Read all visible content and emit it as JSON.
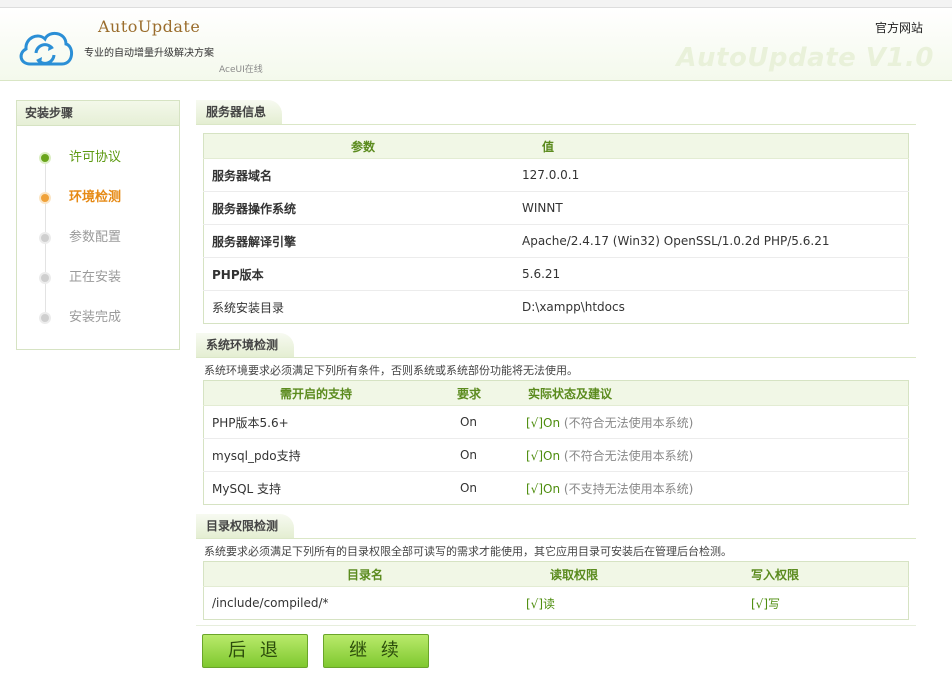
{
  "header": {
    "app_name": "AutoUpdate",
    "slogan": "专业的自动增量升级解决方案",
    "sub": "AceUI在线",
    "official_link": "官方网站",
    "watermark": "AutoUpdate V1.0"
  },
  "sidebar": {
    "title": "安装步骤",
    "steps": [
      {
        "label": "许可协议",
        "state": "done"
      },
      {
        "label": "环境检测",
        "state": "active"
      },
      {
        "label": "参数配置",
        "state": "pending"
      },
      {
        "label": "正在安装",
        "state": "pending"
      },
      {
        "label": "安装完成",
        "state": "pending"
      }
    ]
  },
  "server": {
    "title": "服务器信息",
    "headers": [
      "参数",
      "值"
    ],
    "rows": [
      {
        "param": "服务器域名",
        "value": "127.0.0.1"
      },
      {
        "param": "服务器操作系统",
        "value": "WINNT"
      },
      {
        "param": "服务器解译引擎",
        "value": "Apache/2.4.17 (Win32) OpenSSL/1.0.2d PHP/5.6.21"
      },
      {
        "param": "PHP版本",
        "value": "5.6.21"
      },
      {
        "param": "系统安装目录",
        "value": "D:\\xampp\\htdocs"
      }
    ]
  },
  "env": {
    "title": "系统环境检测",
    "desc": "系统环境要求必须满足下列所有条件，否则系统或系统部份功能将无法使用。",
    "headers": [
      "需开启的支持",
      "要求",
      "实际状态及建议"
    ],
    "rows": [
      {
        "name": "PHP版本5.6+",
        "req": "On",
        "status": "[√]On",
        "hint": "(不符合无法使用本系统)"
      },
      {
        "name": "mysql_pdo支持",
        "req": "On",
        "status": "[√]On",
        "hint": "(不符合无法使用本系统)"
      },
      {
        "name": "MySQL 支持",
        "req": "On",
        "status": "[√]On",
        "hint": "(不支持无法使用本系统)"
      }
    ]
  },
  "dirs": {
    "title": "目录权限检测",
    "desc": "系统要求必须满足下列所有的目录权限全部可读写的需求才能使用，其它应用目录可安装后在管理后台检测。",
    "headers": [
      "目录名",
      "读取权限",
      "写入权限"
    ],
    "rows": [
      {
        "dir": "/include/compiled/*",
        "read": "[√]读",
        "write": "[√]写"
      }
    ]
  },
  "buttons": {
    "back": "后 退",
    "next": "继 续"
  },
  "colors": {
    "accent_green": "#5d9a12",
    "active_orange": "#e68a15",
    "button_green": "#8fd23c"
  }
}
